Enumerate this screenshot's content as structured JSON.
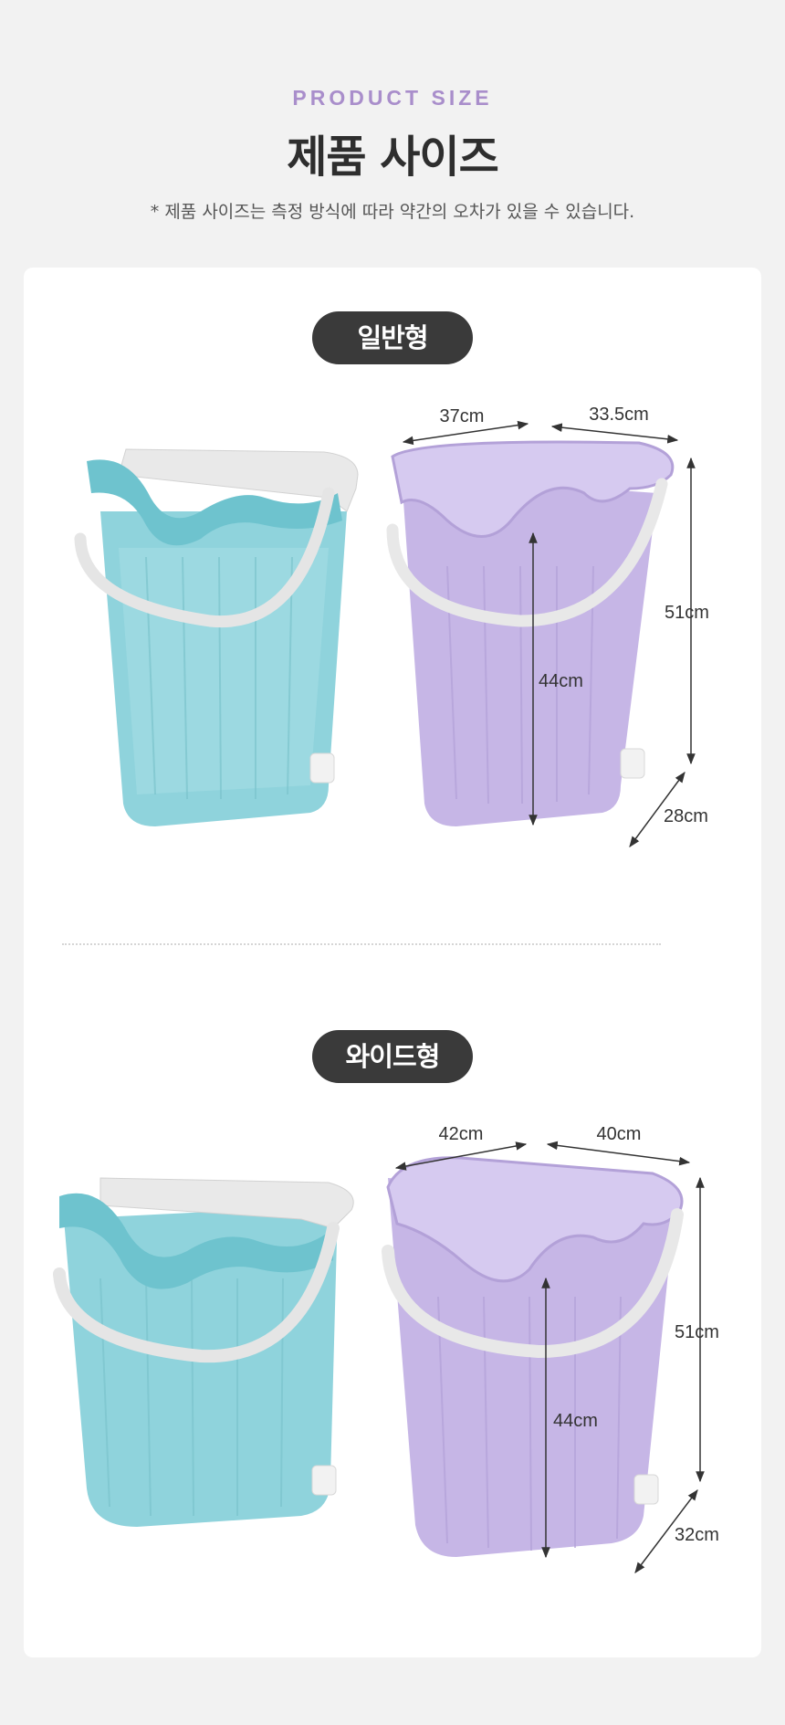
{
  "header": {
    "eyebrow": "PRODUCT SIZE",
    "title": "제품 사이즈",
    "note": "* 제품 사이즈는 측정 방식에 따라 약간의 오차가 있을 수 있습니다."
  },
  "colors": {
    "mint": "#8fd3dc",
    "lavender": "#c6b6e6",
    "handle": "#e7e7e7"
  },
  "sections": [
    {
      "label": "일반형",
      "width": "37cm",
      "depth": "33.5cm",
      "total_height": "51cm",
      "inner_height": "44cm",
      "base": "28cm"
    },
    {
      "label": "와이드형",
      "width": "42cm",
      "depth": "40cm",
      "total_height": "51cm",
      "inner_height": "44cm",
      "base": "32cm"
    }
  ]
}
